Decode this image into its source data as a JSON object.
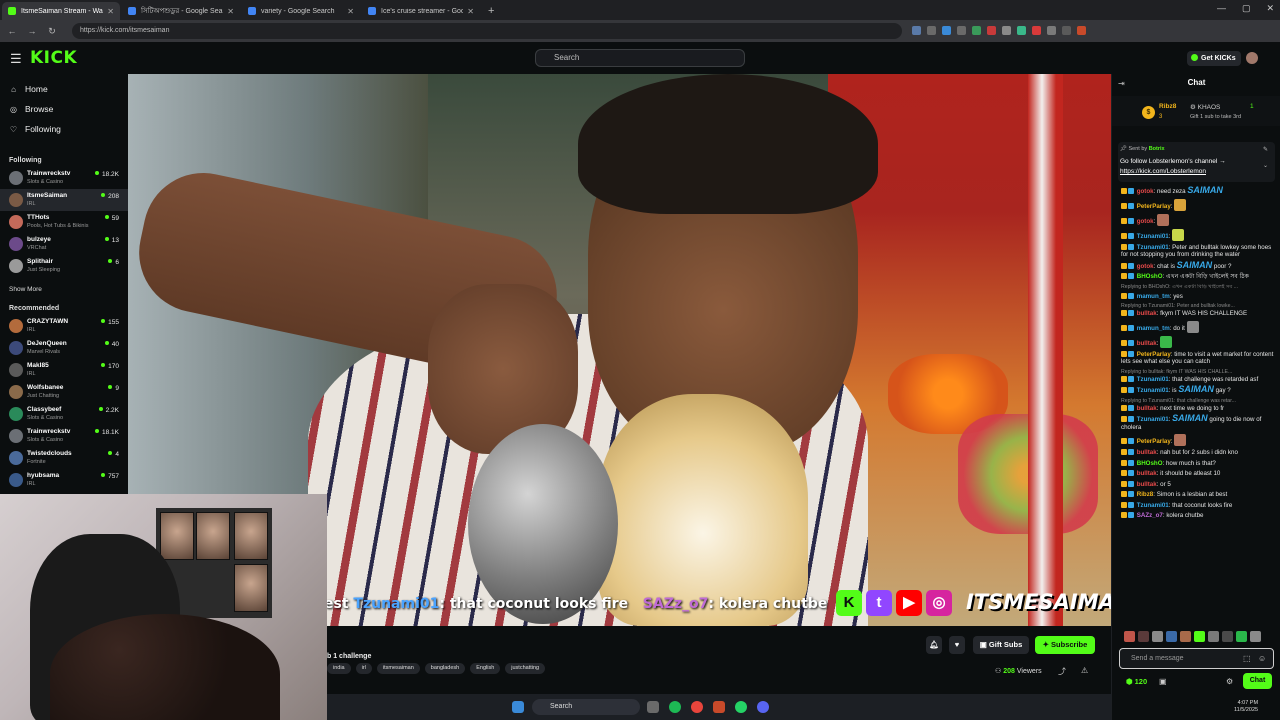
{
  "browser": {
    "tabs": [
      {
        "title": "ItsmeSaiman Stream - Wat",
        "active": true,
        "color": "#53fc18"
      },
      {
        "title": "সিটিঅপশুডুর - Google Search",
        "active": false,
        "color": "#4285f4"
      },
      {
        "title": "variety - Google Search",
        "active": false,
        "color": "#4285f4"
      },
      {
        "title": "Ice's cruise streamer - Google S",
        "active": false,
        "color": "#4285f4"
      }
    ],
    "url": "https://kick.com/itsmesaiman",
    "new_tab": "+",
    "window_controls": [
      "—",
      "▢",
      "✕"
    ]
  },
  "header": {
    "logo": "KICK",
    "search_placeholder": "Search",
    "get_kicks": "Get KICKs"
  },
  "sidebar": {
    "nav": [
      {
        "label": "Home",
        "icon": "home-icon",
        "glyph": "⌂"
      },
      {
        "label": "Browse",
        "icon": "compass-icon",
        "glyph": "◎"
      },
      {
        "label": "Following",
        "icon": "heart-icon",
        "glyph": "♡"
      }
    ],
    "following_header": "Following",
    "following": [
      {
        "name": "Trainwreckstv",
        "category": "Slots & Casino",
        "viewers": "18.2K",
        "color": "#6b6f75"
      },
      {
        "name": "ItsmeSaiman",
        "category": "IRL",
        "viewers": "208",
        "color": "#7a5a45",
        "selected": true
      },
      {
        "name": "TTHots",
        "category": "Pools, Hot Tubs & Bikinis",
        "viewers": "59",
        "color": "#c46a5a"
      },
      {
        "name": "bulzeye",
        "category": "VRChat",
        "viewers": "13",
        "color": "#6c4a8a"
      },
      {
        "name": "Splithair",
        "category": "Just Sleeping",
        "viewers": "6",
        "color": "#9a9a9a"
      }
    ],
    "show_more": "Show More",
    "recommended_header": "Recommended",
    "recommended": [
      {
        "name": "CRAZYTAWN",
        "category": "IRL",
        "viewers": "155",
        "color": "#b36b3c"
      },
      {
        "name": "DeJenQueen",
        "category": "Marvel Rivals",
        "viewers": "40",
        "color": "#3c4a7a"
      },
      {
        "name": "MakI85",
        "category": "IRL",
        "viewers": "170",
        "color": "#5a5a5a"
      },
      {
        "name": "Wolfsbanee",
        "category": "Just Chatting",
        "viewers": "9",
        "color": "#8a6a4a"
      },
      {
        "name": "Classybeef",
        "category": "Slots & Casino",
        "viewers": "2.2K",
        "color": "#2a8a5a"
      },
      {
        "name": "Trainwreckstv",
        "category": "Slots & Casino",
        "viewers": "18.1K",
        "color": "#6b6f75"
      },
      {
        "name": "Twistedclouds",
        "category": "Fortnite",
        "viewers": "4",
        "color": "#4a6a9a"
      },
      {
        "name": "hyubsama",
        "category": "IRL",
        "viewers": "757",
        "color": "#3a5a8a"
      }
    ]
  },
  "video": {
    "overlay_prefix": "est",
    "overlay_user1": "Tzunami01",
    "overlay_msg1": ": that coconut looks fire",
    "overlay_user2": "SAZz_o7",
    "overlay_msg2": ": kolera chutbe",
    "brand_icons": [
      "K",
      "t",
      "▶",
      "◎"
    ],
    "brand_name": "ITSMESAIMAN"
  },
  "stream": {
    "title": "b 1 challenge",
    "tags": [
      "india",
      "irl",
      "itsmesaiman",
      "bangladesh",
      "English",
      "justchatting"
    ],
    "gift_subs": "Gift Subs",
    "subscribe": "Subscribe",
    "viewers_count": "208",
    "viewers_label": "Viewers"
  },
  "taskbar": {
    "search": "Search",
    "clock_time": "4:07 PM",
    "clock_date": "11/5/2025"
  },
  "chat": {
    "title": "Chat",
    "gift_user": "Ribz8",
    "gift_level": "3",
    "gift_channel": "KHAOS",
    "gift_count": "1",
    "gift_text": "Gift 1 sub to take 3rd",
    "pinned_sent_by": "Sent by",
    "pinned_bot": "Botrix",
    "pinned_msg": "Go follow Lobsterlemon's channel →",
    "pinned_link": "https://kick.com/Lobsterlemon",
    "messages": [
      {
        "user": "gotok",
        "color": "#e84a4a",
        "emote_text": "SAIMAN",
        "text": "need zeza"
      },
      {
        "user": "PeterParlay",
        "color": "#f2b51c",
        "text": "",
        "emoji": "#d9a33a"
      },
      {
        "user": "gotok",
        "color": "#e84a4a",
        "text": "",
        "emoji": "#b0705a"
      },
      {
        "user": "Tzunami01",
        "color": "#38a9e8",
        "text": "",
        "emoji": "#c8d84a"
      },
      {
        "user": "Tzunami01",
        "color": "#38a9e8",
        "text": "Peter and bulltak lowkey some hoes for not stopping you from drinking the water"
      },
      {
        "user": "gotok",
        "color": "#e84a4a",
        "text": "chat is",
        "emote_text": "SAIMAN",
        "text2": "poor ?"
      },
      {
        "user": "BHOshO",
        "color": "#53fc18",
        "text": "এখন একটা বিড়ি খাইলেই সব ঠিক"
      },
      {
        "reply": "Replying to BHOshO: এখন একটা বিড়ি খাইলেই সব ..."
      },
      {
        "user": "mamun_tm",
        "color": "#38a9e8",
        "text": "yes"
      },
      {
        "reply": "Replying to Tzunami01: Peter and bulltak lowke..."
      },
      {
        "user": "bulltak",
        "color": "#e84a4a",
        "text": "fkym IT WAS HIS CHALLENGE"
      },
      {
        "user": "mamun_tm",
        "color": "#38a9e8",
        "text": "do it",
        "emoji": "#8a8a8a"
      },
      {
        "user": "bulltak",
        "color": "#e84a4a",
        "text": "",
        "emoji": "#3ab84a"
      },
      {
        "user": "PeterParlay",
        "color": "#f2b51c",
        "text": "time to visit a wet market for content lets see what else you can catch"
      },
      {
        "reply": "Replying to bulltak: fkym IT WAS HIS CHALLE..."
      },
      {
        "user": "Tzunami01",
        "color": "#38a9e8",
        "text": "that challenge was retarded asf"
      },
      {
        "user": "Tzunami01",
        "color": "#38a9e8",
        "text": "is",
        "emote_text": "SAIMAN",
        "text2": "gay ?"
      },
      {
        "reply": "Replying to Tzunami01: that challenge was retar..."
      },
      {
        "user": "bulltak",
        "color": "#e84a4a",
        "text": "next time we doing to fr"
      },
      {
        "user": "Tzunami01",
        "color": "#38a9e8",
        "text": "",
        "emote_text": "SAIMAN",
        "text2": "going to die now of cholera"
      },
      {
        "user": "PeterParlay",
        "color": "#f2b51c",
        "text": "",
        "emoji": "#b0705a"
      },
      {
        "user": "bulltak",
        "color": "#e84a4a",
        "text": "nah but for 2 subs i didn kno"
      },
      {
        "user": "BHOshO",
        "color": "#53fc18",
        "text": "how much is that?"
      },
      {
        "user": "bulltak",
        "color": "#e84a4a",
        "text": "it should be atleast 10"
      },
      {
        "user": "bulltak",
        "color": "#e84a4a",
        "text": "or 5"
      },
      {
        "user": "Ribz8",
        "color": "#f2b51c",
        "text": "Simon is a lesbian at best"
      },
      {
        "user": "Tzunami01",
        "color": "#38a9e8",
        "text": "that coconut looks fire"
      },
      {
        "user": "SAZz_o7",
        "color": "#c06bd6",
        "text": "kolera chutbe"
      }
    ],
    "input_placeholder": "Send a message",
    "kicks_balance": "120",
    "chat_button": "Chat"
  }
}
